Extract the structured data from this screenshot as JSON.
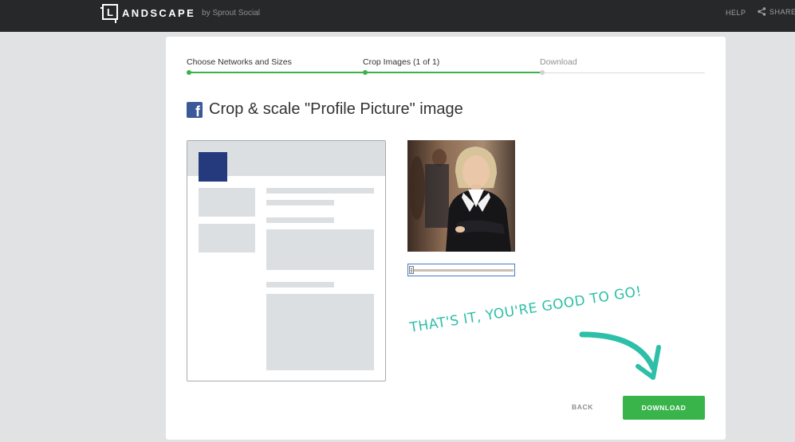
{
  "app": {
    "logo_letter": "L",
    "logo_word": "ANDSCAPE",
    "logo_by": "by Sprout Social"
  },
  "topnav": {
    "help_label": "HELP",
    "share_label": "SHARE",
    "share_icon": "share-icon"
  },
  "steps": [
    {
      "label": "Choose Networks and Sizes",
      "state": "complete"
    },
    {
      "label": "Crop Images (1 of 1)",
      "state": "current"
    },
    {
      "label": "Download",
      "state": "upcoming"
    }
  ],
  "heading": {
    "network_icon": "facebook-icon",
    "network_icon_glyph": "f",
    "text": "Crop & scale \"Profile Picture\" image"
  },
  "crop_slider": {
    "value": 0
  },
  "note": {
    "text": "THAT'S IT, YOU'RE GOOD TO GO!"
  },
  "actions": {
    "back_label": "BACK",
    "download_label": "DOWNLOAD"
  },
  "colors": {
    "accent_green": "#38b44a",
    "facebook_blue": "#3b5998",
    "avatar_navy": "#253a7c",
    "note_teal": "#2dbfa7",
    "topbar": "#262829"
  }
}
